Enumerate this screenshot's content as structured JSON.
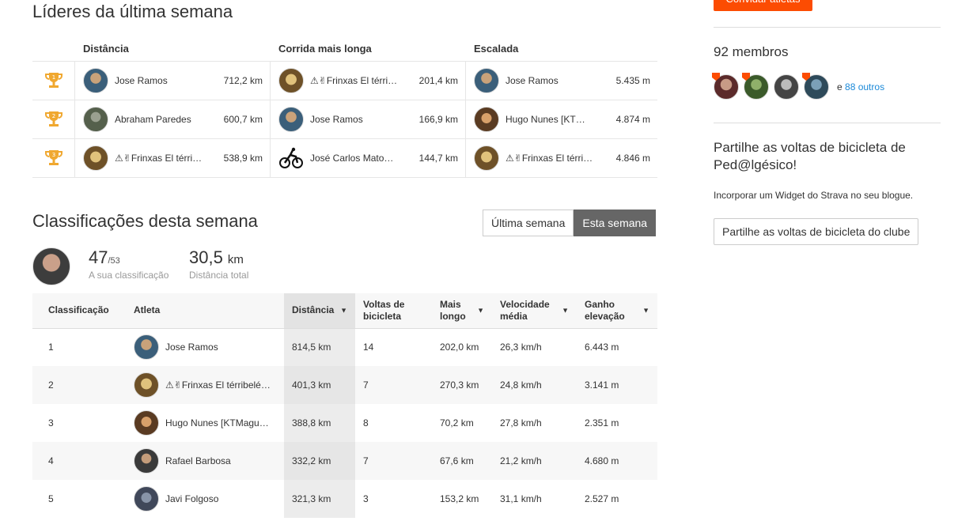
{
  "leaders": {
    "title": "Líderes da última semana",
    "columns": [
      "Distância",
      "Corrida mais longa",
      "Escalada"
    ],
    "rows": [
      {
        "rank": "1",
        "cells": [
          {
            "name": "Jose Ramos",
            "value": "712,2 km"
          },
          {
            "name": "⚠✌Frinxas El térri…",
            "value": "201,4 km"
          },
          {
            "name": "Jose Ramos",
            "value": "5.435 m"
          }
        ]
      },
      {
        "rank": "2",
        "cells": [
          {
            "name": "Abraham Paredes",
            "value": "600,7 km"
          },
          {
            "name": "Jose Ramos",
            "value": "166,9 km"
          },
          {
            "name": "Hugo Nunes [KT…",
            "value": "4.874 m"
          }
        ]
      },
      {
        "rank": "3",
        "cells": [
          {
            "name": "⚠✌Frinxas El térri…",
            "value": "538,9 km"
          },
          {
            "name": "José Carlos Mato…",
            "value": "144,7 km"
          },
          {
            "name": "⚠✌Frinxas El térri…",
            "value": "4.846 m"
          }
        ]
      }
    ]
  },
  "classification": {
    "title": "Classificações desta semana",
    "toggle": {
      "last_week": "Última semana",
      "this_week": "Esta semana"
    },
    "mine": {
      "rank": "47",
      "total": "/53",
      "rank_label": "A sua classificação",
      "distance": "30,5",
      "distance_unit": "km",
      "distance_label": "Distância total"
    },
    "headers": {
      "rank": "Classificação",
      "athlete": "Atleta",
      "distance": "Distância",
      "rides_1": "Voltas de",
      "rides_2": "bicicleta",
      "longest_1": "Mais",
      "longest_2": "longo",
      "speed_1": "Velocidade",
      "speed_2": "média",
      "elev_1": "Ganho",
      "elev_2": "elevação"
    },
    "sort_glyph": "▼",
    "rows": [
      {
        "rank": "1",
        "athlete": "Jose Ramos",
        "distance": "814,5 km",
        "rides": "14",
        "longest": "202,0 km",
        "speed": "26,3 km/h",
        "elevation": "6.443 m"
      },
      {
        "rank": "2",
        "athlete": "⚠✌Frinxas El térribelé©®",
        "distance": "401,3 km",
        "rides": "7",
        "longest": "270,3 km",
        "speed": "24,8 km/h",
        "elevation": "3.141 m"
      },
      {
        "rank": "3",
        "athlete": "Hugo Nunes [KTMagu…",
        "distance": "388,8 km",
        "rides": "8",
        "longest": "70,2 km",
        "speed": "27,8 km/h",
        "elevation": "2.351 m"
      },
      {
        "rank": "4",
        "athlete": "Rafael Barbosa",
        "distance": "332,2 km",
        "rides": "7",
        "longest": "67,6 km",
        "speed": "21,2 km/h",
        "elevation": "4.680 m"
      },
      {
        "rank": "5",
        "athlete": "Javi Folgoso",
        "distance": "321,3 km",
        "rides": "3",
        "longest": "153,2 km",
        "speed": "31,1 km/h",
        "elevation": "2.527 m"
      }
    ]
  },
  "sidebar": {
    "invite_button": "Convidar atletas",
    "members_count": "92 membros",
    "more_prefix": "e",
    "more_link": "88 outros",
    "share_title": "Partilhe as voltas de bicicleta de Ped@lgésico!",
    "share_text": "Incorporar um Widget do Strava no seu blogue.",
    "share_button": "Partilhe as voltas de bicicleta do clube"
  },
  "colors": {
    "brand": "#fc4c02",
    "trophy": "#f0a830",
    "link": "#1c8ad9"
  }
}
